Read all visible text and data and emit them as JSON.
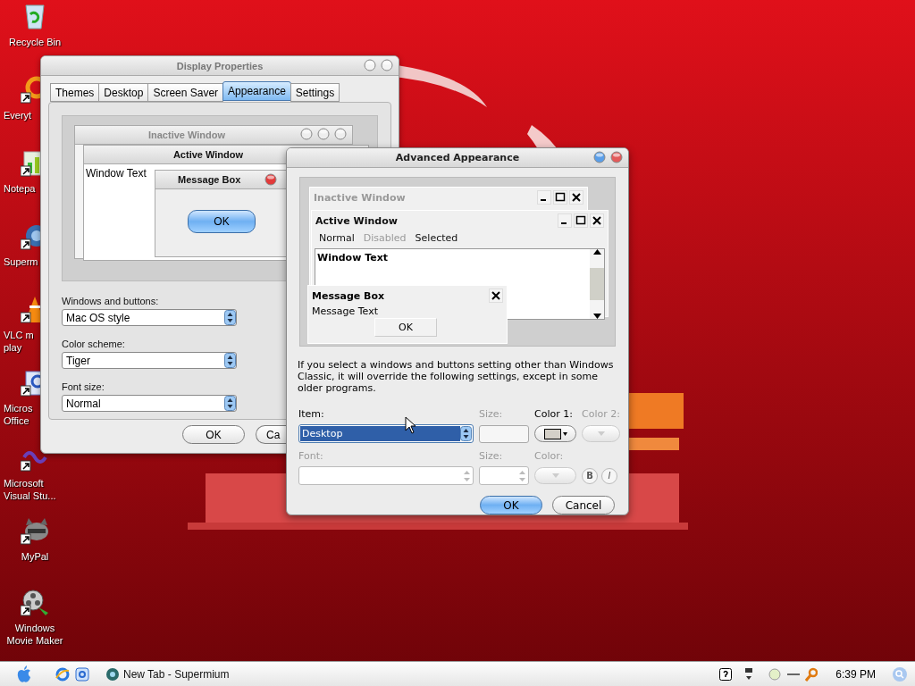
{
  "desktop_icons": [
    {
      "lines": [
        "Recycle Bin"
      ]
    },
    {
      "lines": [
        "Everyt"
      ]
    },
    {
      "lines": [
        "Notepa"
      ]
    },
    {
      "lines": [
        "Superm"
      ]
    },
    {
      "lines": [
        "VLC m",
        "play"
      ]
    },
    {
      "lines": [
        "Micros",
        "Office"
      ]
    },
    {
      "lines": [
        "Microsoft",
        "Visual Stu..."
      ]
    },
    {
      "lines": [
        "MyPal"
      ]
    },
    {
      "lines": [
        "Windows",
        "Movie Maker"
      ]
    }
  ],
  "display_properties": {
    "title": "Display Properties",
    "tabs": [
      {
        "label": "Themes",
        "selected": false
      },
      {
        "label": "Desktop",
        "selected": false
      },
      {
        "label": "Screen Saver",
        "selected": false
      },
      {
        "label": "Appearance",
        "selected": true
      },
      {
        "label": "Settings",
        "selected": false
      }
    ],
    "preview": {
      "inactive_title": "Inactive Window",
      "active_title": "Active Window",
      "window_text": "Window Text",
      "message_title": "Message Box",
      "ok": "OK"
    },
    "fields": [
      {
        "label": "Windows and buttons:",
        "value": "Mac OS style"
      },
      {
        "label": "Color scheme:",
        "value": "Tiger"
      },
      {
        "label": "Font size:",
        "value": "Normal"
      }
    ],
    "buttons": [
      "OK",
      "Ca"
    ]
  },
  "advanced": {
    "title": "Advanced Appearance",
    "preview": {
      "inactive_title": "Inactive Window",
      "active_title": "Active Window",
      "menu": [
        {
          "label": "Normal",
          "disabled": false
        },
        {
          "label": "Disabled",
          "disabled": true
        },
        {
          "label": "Selected",
          "disabled": false
        }
      ],
      "window_text": "Window Text",
      "message_title": "Message Box",
      "message_text": "Message Text",
      "ok": "OK"
    },
    "note": "If you select a windows and buttons setting other than Windows Classic, it will override the following settings, except in some older programs.",
    "item": {
      "label": "Item:",
      "value": "Desktop"
    },
    "labels": [
      {
        "label": "Size:",
        "disabled": true
      },
      {
        "label": "Color 1:",
        "disabled": false
      },
      {
        "label": "Color 2:",
        "disabled": true
      },
      {
        "label": "Font:",
        "disabled": true
      },
      {
        "label": "Size:",
        "disabled": true
      },
      {
        "label": "Color:",
        "disabled": true
      }
    ],
    "bold": "B",
    "italic": "I",
    "buttons": [
      "OK",
      "Cancel"
    ]
  },
  "taskbar": {
    "task": "New Tab - Supermium",
    "clock": "6:39 PM"
  }
}
